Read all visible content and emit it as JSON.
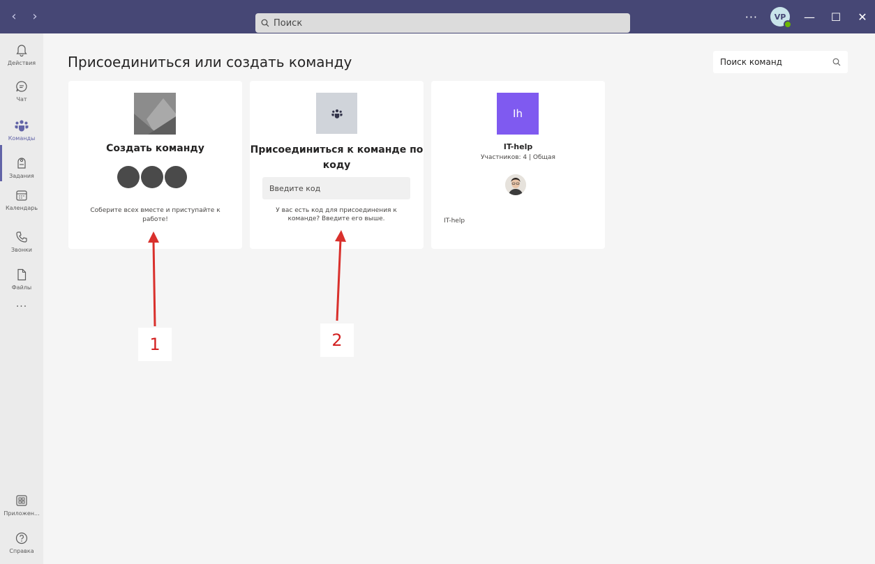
{
  "titlebar": {
    "back_icon": "chevron-left-icon",
    "forward_icon": "chevron-right-icon",
    "search_placeholder": "Поиск",
    "more": "···",
    "avatar_initials": "VP",
    "minimize": "—",
    "maximize": "☐",
    "close": "✕",
    "bg_color": "#464775"
  },
  "rail": {
    "items": [
      {
        "label": "Действия",
        "icon": "bell-icon"
      },
      {
        "label": "Чат",
        "icon": "chat-icon"
      },
      {
        "label": "Команды",
        "icon": "teams-icon"
      },
      {
        "label": "Задания",
        "icon": "assignments-icon"
      },
      {
        "label": "Календарь",
        "icon": "calendar-icon"
      },
      {
        "label": "Звонки",
        "icon": "phone-icon"
      },
      {
        "label": "Файлы",
        "icon": "file-icon"
      }
    ],
    "more": "···",
    "apps_label": "Приложен...",
    "help_label": "Справка",
    "accent": "#6264a7"
  },
  "main": {
    "title": "Присоединиться или создать команду",
    "team_search_placeholder": "Поиск команд"
  },
  "cards": {
    "create": {
      "title": "Создать команду",
      "description": "Соберите всех вместе и приступайте к работе!"
    },
    "join": {
      "title": "Присоединиться к команде по коду",
      "code_placeholder": "Введите код",
      "description": "У вас есть код для присоединения к команде? Введите его выше."
    },
    "team": {
      "tile_initials": "Ih",
      "name": "IT-help",
      "meta": "Участников: 4 | Общая",
      "footer": "IT-help",
      "tile_color": "#7f5af0"
    }
  },
  "annotations": {
    "label1": "1",
    "label2": "2",
    "color": "#d32020"
  }
}
